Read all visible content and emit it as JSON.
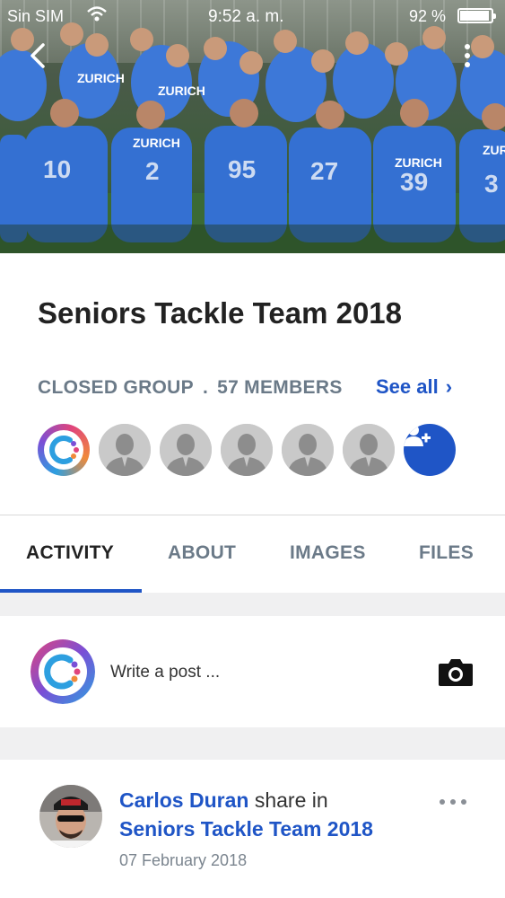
{
  "status_bar": {
    "carrier": "Sin SIM",
    "time": "9:52 a. m.",
    "battery": "92 %"
  },
  "group": {
    "title": "Seniors Tackle Team 2018",
    "privacy": "CLOSED GROUP",
    "separator": ".",
    "members_count": "57 MEMBERS",
    "see_all": "See all"
  },
  "jersey_texts": [
    "ZURICH",
    "ZURICH",
    "ZURICH",
    "ZURICH",
    "ZUR"
  ],
  "jersey_numbers": [
    "10",
    "2",
    "95",
    "27",
    "39",
    "3"
  ],
  "tabs": [
    {
      "label": "ACTIVITY"
    },
    {
      "label": "ABOUT"
    },
    {
      "label": "IMAGES"
    },
    {
      "label": "FILES"
    }
  ],
  "composer": {
    "placeholder": "Write a post ..."
  },
  "post": {
    "author": "Carlos Duran",
    "action": " share in",
    "group": "Seniors Tackle Team 2018",
    "date": "07 February 2018"
  },
  "colors": {
    "accent": "#1f55c6",
    "muted": "#6b7a88",
    "jersey": "#3d78d8"
  },
  "icons": {
    "back": "chevron-left-icon",
    "more": "more-vertical-icon",
    "add_member": "add-user-icon",
    "camera": "camera-icon",
    "post_more": "more-horizontal-icon"
  }
}
